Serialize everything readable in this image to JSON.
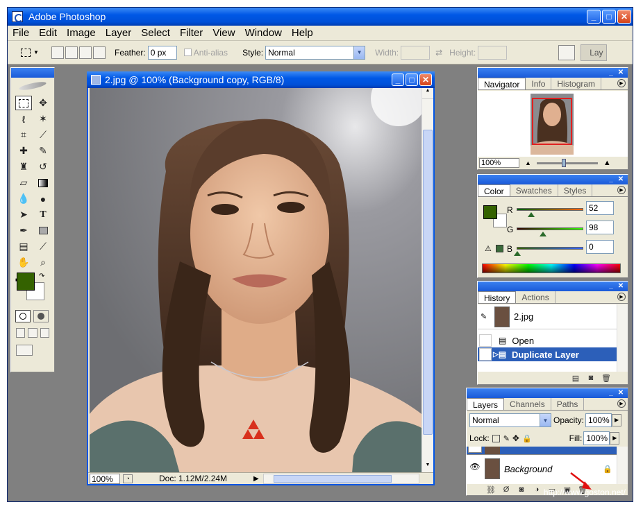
{
  "window": {
    "title": "Adobe Photoshop",
    "minimize": "_",
    "maximize": "□",
    "close": "✕"
  },
  "menu": [
    "File",
    "Edit",
    "Image",
    "Layer",
    "Select",
    "Filter",
    "View",
    "Window",
    "Help"
  ],
  "options": {
    "feather_label": "Feather:",
    "feather_value": "0 px",
    "antialias_label": "Anti-alias",
    "style_label": "Style:",
    "style_value": "Normal",
    "width_label": "Width:",
    "height_label": "Height:",
    "palette_tab": "Lay"
  },
  "document": {
    "title": "2.jpg @ 100% (Background copy, RGB/8)",
    "zoom": "100%",
    "doc_info": "Doc: 1.12M/2.24M"
  },
  "navigator": {
    "tabs": [
      "Navigator",
      "Info",
      "Histogram"
    ],
    "zoom": "100%"
  },
  "color": {
    "tabs": [
      "Color",
      "Swatches",
      "Styles"
    ],
    "r_label": "R",
    "r_value": "52",
    "g_label": "G",
    "g_value": "98",
    "b_label": "B",
    "b_value": "0",
    "foreground": "#346200"
  },
  "history": {
    "tabs": [
      "History",
      "Actions"
    ],
    "snapshot": "2.jpg",
    "items": [
      "Open",
      "Duplicate Layer"
    ]
  },
  "layers": {
    "tabs": [
      "Layers",
      "Channels",
      "Paths"
    ],
    "blend_mode": "Normal",
    "opacity_label": "Opacity:",
    "opacity_value": "100%",
    "lock_label": "Lock:",
    "fill_label": "Fill:",
    "fill_value": "100%",
    "background_layer": "Background"
  },
  "watermark": "http://www.goston.net/"
}
